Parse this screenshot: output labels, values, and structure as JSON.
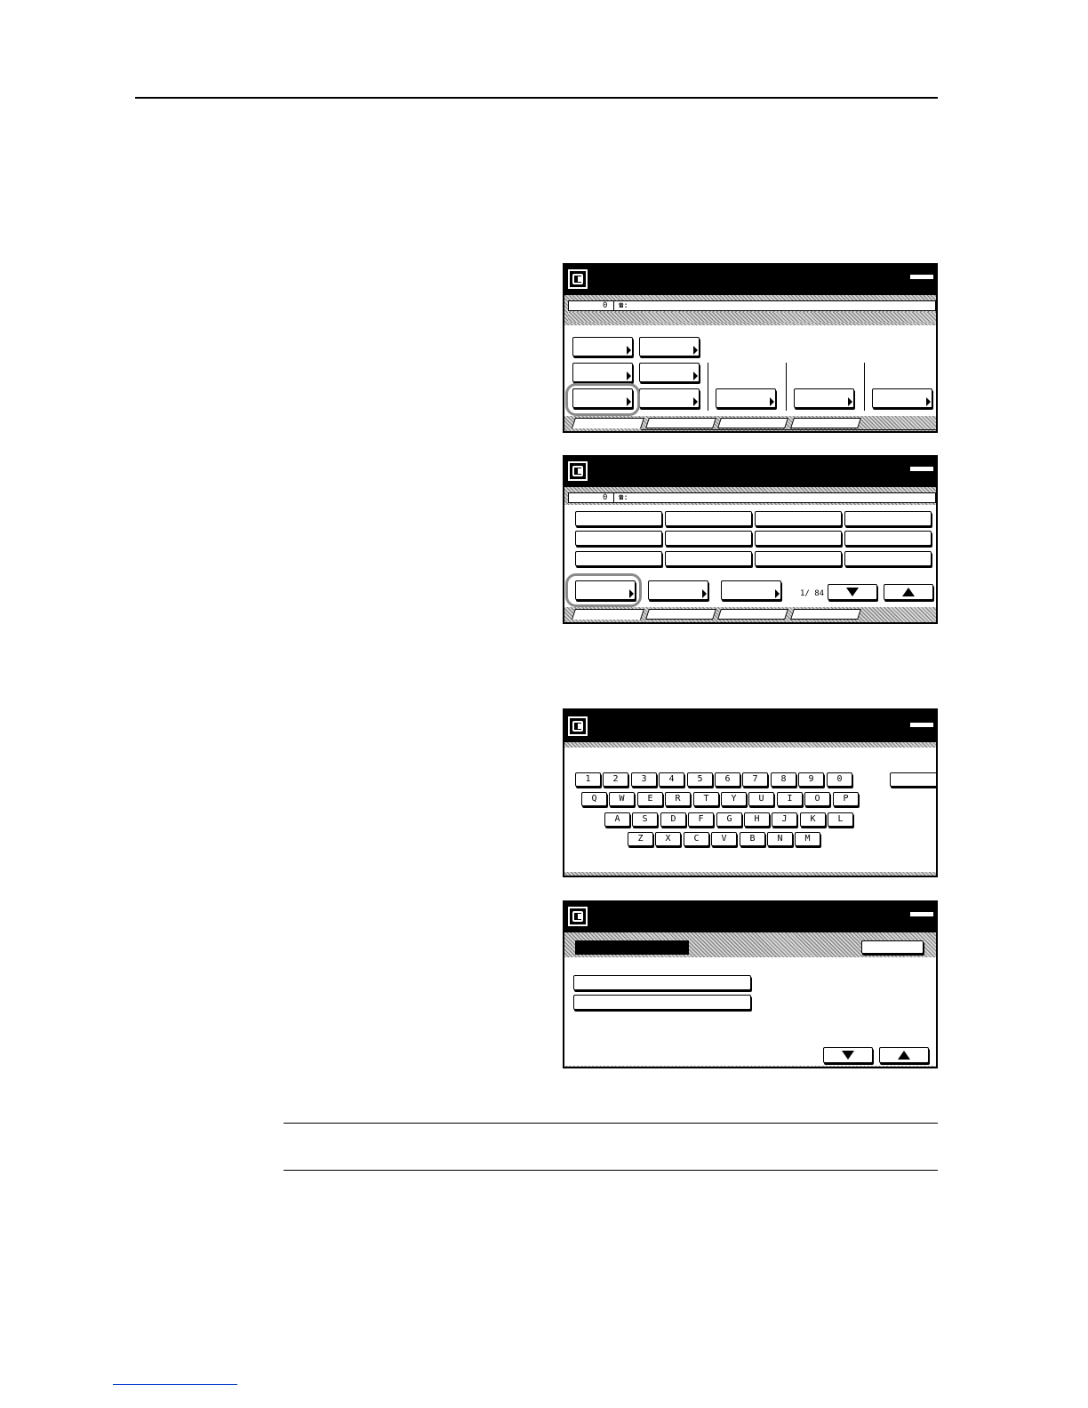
{
  "screens": {
    "screen1": {
      "counter": "0",
      "phone_icon": "telephone-icon",
      "phone_sep": ":"
    },
    "screen2": {
      "counter": "0",
      "phone_icon": "telephone-icon",
      "phone_sep": ":",
      "page_indicator": "1/ 84"
    },
    "screen3": {
      "keyboard_rows": [
        [
          "1",
          "2",
          "3",
          "4",
          "5",
          "6",
          "7",
          "8",
          "9",
          "0"
        ],
        [
          "Q",
          "W",
          "E",
          "R",
          "T",
          "Y",
          "U",
          "I",
          "O",
          "P"
        ],
        [
          "A",
          "S",
          "D",
          "F",
          "G",
          "H",
          "J",
          "K",
          "L"
        ],
        [
          "Z",
          "X",
          "C",
          "V",
          "B",
          "N",
          "M"
        ]
      ]
    },
    "screen4": {}
  }
}
